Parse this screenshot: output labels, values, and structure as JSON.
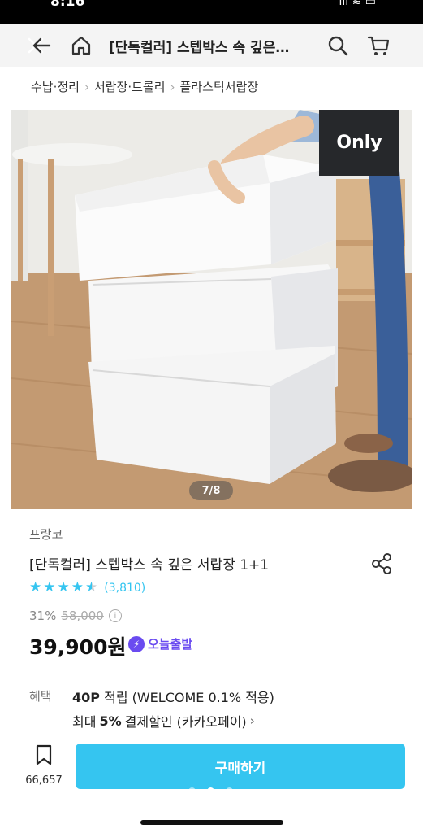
{
  "status": {
    "time": "8:16",
    "indicators": "ııl ≋ ▭"
  },
  "topbar": {
    "title": "[단독컬러] 스텝박스 속 깊은…",
    "icons": [
      "close-icon",
      "back-arrow-icon",
      "home-icon",
      "search-icon",
      "cart-icon"
    ]
  },
  "breadcrumb": [
    "수납·정리",
    "서랍장·트롤리",
    "플라스틱서랍장"
  ],
  "hero": {
    "badge": "Only",
    "page_indicator": "7/8"
  },
  "product": {
    "brand": "프랑코",
    "title": "[단독컬러] 스텝박스 속 깊은 서랍장 1+1",
    "rating": 4.5,
    "review_count": "(3,810)",
    "discount": "31%",
    "original_price": "58,000",
    "price": "39,900원",
    "delivery_badge": "오늘출발"
  },
  "benefits": {
    "label": "혜택",
    "points": "40P",
    "points_text": "적립 (WELCOME 0.1% 적용)",
    "max_prefix": "최대",
    "max_percent": "5%",
    "max_text": "결제할인 (카카오페이)"
  },
  "bottom": {
    "bookmark_count": "66,657",
    "buy_label": "구매하기"
  },
  "colors": {
    "accent": "#35c5f0",
    "badge_purple": "#6a4bf0",
    "badge_dark": "#26282b"
  }
}
